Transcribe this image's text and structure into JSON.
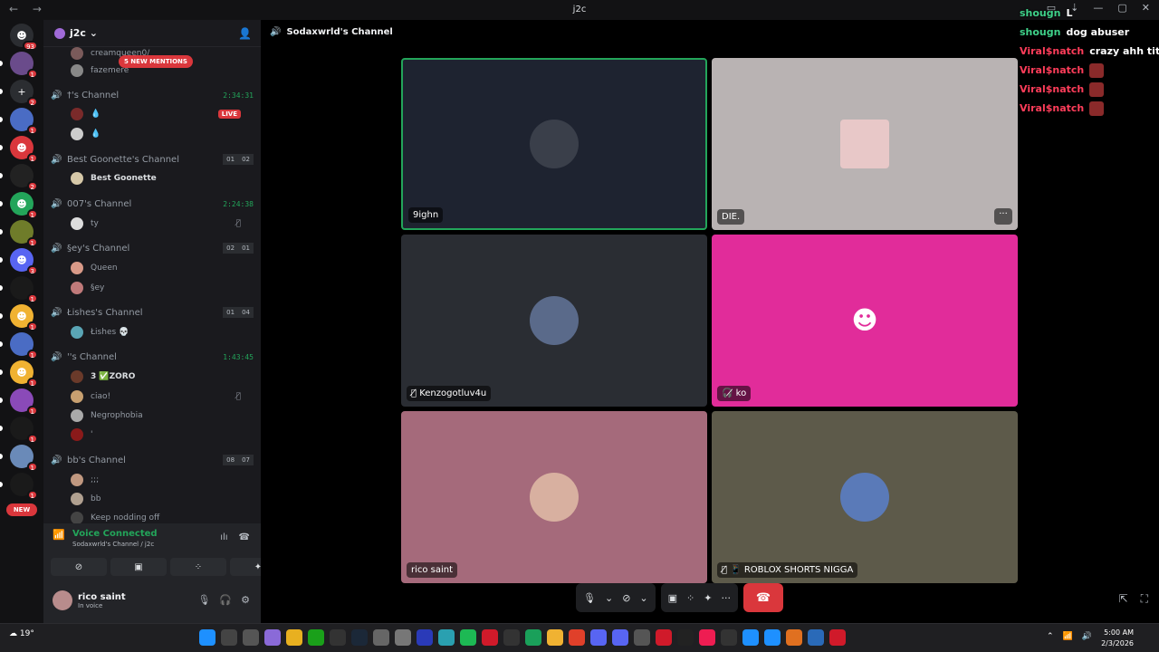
{
  "window": {
    "title": "j2c",
    "nav": "← →",
    "controls": [
      "▭",
      "⇣",
      "—",
      "▢",
      "✕"
    ]
  },
  "servers": {
    "items": [
      {
        "icon": "discord-home-icon",
        "badge": "93",
        "color": "#2b2d31"
      },
      {
        "icon": "server-icon",
        "badge": "1",
        "color": "#6a4b8b"
      },
      {
        "icon": "add-server-icon",
        "badge": "2",
        "color": "#2b2d31"
      },
      {
        "icon": "server-icon",
        "badge": "1",
        "color": "#4a6cc4"
      },
      {
        "icon": "discord-icon",
        "badge": "1",
        "color": "#da373c"
      },
      {
        "icon": "server-icon",
        "badge": "2",
        "color": "#222"
      },
      {
        "icon": "discord-icon",
        "badge": "1",
        "color": "#23a55a"
      },
      {
        "icon": "server-icon",
        "badge": "1",
        "color": "#6f7c2a"
      },
      {
        "icon": "discord-icon",
        "badge": "3",
        "color": "#5865f2"
      },
      {
        "icon": "server-icon",
        "badge": "1",
        "color": "#1a1a1a"
      },
      {
        "icon": "discord-icon",
        "badge": "1",
        "color": "#f0b232"
      },
      {
        "icon": "server-icon",
        "badge": "1",
        "color": "#4a6cc4"
      },
      {
        "icon": "discord-icon",
        "badge": "1",
        "color": "#f0b232"
      },
      {
        "icon": "server-icon",
        "badge": "1",
        "color": "#8a4ab8"
      },
      {
        "icon": "server-icon",
        "badge": "1",
        "color": "#1a1a1a"
      },
      {
        "icon": "server-icon",
        "badge": "1",
        "color": "#6a8ab8"
      },
      {
        "icon": "server-icon",
        "badge": "1",
        "color": "#1a1a1a"
      }
    ],
    "new_label": "NEW"
  },
  "guild": {
    "name": "j2c"
  },
  "mentions_label": "5 NEW MENTIONS",
  "channels": [
    {
      "name": "creamqueen0/",
      "member": true
    },
    {
      "name": "fazemere",
      "member": true
    },
    {
      "name": "†'s Channel",
      "timer": "2:34:31"
    },
    {
      "m1": "💧",
      "m2": "💧",
      "live": "LIVE"
    },
    {
      "name": "Best Goonette's Channel",
      "c1": "01",
      "c2": "02",
      "member_name": "Best Goonette"
    },
    {
      "name": "007's Channel",
      "timer": "2:24:38",
      "member_name": "ty"
    },
    {
      "name": "§ey's Channel",
      "c1": "02",
      "c2": "01",
      "m1": "Queen",
      "m2": "§ey"
    },
    {
      "name": "Łishes's Channel",
      "c1": "01",
      "c2": "04",
      "m1": "Łishes 💀"
    },
    {
      "name": "''s Channel",
      "timer": "1:43:45",
      "m1": "3 ✅ZORO",
      "m2": "ciao!",
      "m3": "Negrophobia",
      "m4": "'"
    },
    {
      "name": "bb's Channel",
      "c1": "08",
      "c2": "07",
      "m1": ";;;",
      "m2": "bb",
      "m3": "Keep nodding off"
    }
  ],
  "voice": {
    "status": "Voice Connected",
    "channel": "Sodaxwrld's Channel / j2c"
  },
  "user": {
    "name": "rico saint",
    "status": "In voice"
  },
  "stage": {
    "title": "Sodaxwrld's Channel",
    "tiles": [
      {
        "label": "9ighn",
        "bg": "#1e2330"
      },
      {
        "label": "DIE.",
        "bg": "#b9b3b3"
      },
      {
        "label": "Kenzogotluv4u",
        "bg": "#2a2d33"
      },
      {
        "label": "ko",
        "bg": "#e12c9a"
      },
      {
        "label": "rico saint",
        "bg": "#a56a7b"
      },
      {
        "label": "ROBLOX SHORTS NIGGA",
        "bg": "#5d5a4a"
      }
    ]
  },
  "overlay": [
    {
      "user": "shougn",
      "msg": "L",
      "color": "#3fd28a"
    },
    {
      "user": "shougn",
      "msg": "dog abuser",
      "color": "#3fd28a"
    },
    {
      "user": "Viral$natch",
      "msg": "crazy ahh title",
      "color": "#ff3d5a"
    },
    {
      "user": "Viral$natch",
      "msg": "",
      "color": "#ff3d5a"
    },
    {
      "user": "Viral$natch",
      "msg": "",
      "color": "#ff3d5a"
    },
    {
      "user": "Viral$natch",
      "msg": "",
      "color": "#ff3d5a"
    }
  ],
  "taskbar": {
    "temp": "19°",
    "time": "5:00 AM",
    "date": "2/3/2026"
  }
}
